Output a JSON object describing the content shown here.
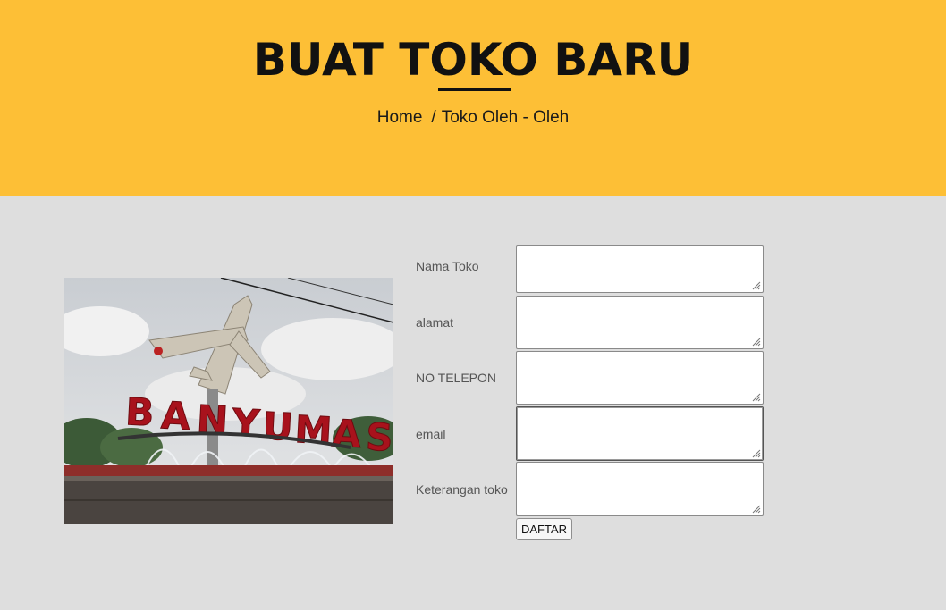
{
  "hero": {
    "title": "BUAT TOKO BARU",
    "breadcrumb": {
      "home": "Home",
      "separator": "/",
      "current": "Toko Oleh - Oleh"
    },
    "background": "#fdbf36"
  },
  "photo": {
    "sign_text": "BANYUMAS"
  },
  "form": {
    "fields": [
      {
        "label": "Nama Toko",
        "value": ""
      },
      {
        "label": "alamat",
        "value": ""
      },
      {
        "label": "NO TELEPON",
        "value": ""
      },
      {
        "label": "email",
        "value": ""
      },
      {
        "label": "Keterangan toko",
        "value": ""
      }
    ],
    "submit_label": "DAFTAR"
  }
}
